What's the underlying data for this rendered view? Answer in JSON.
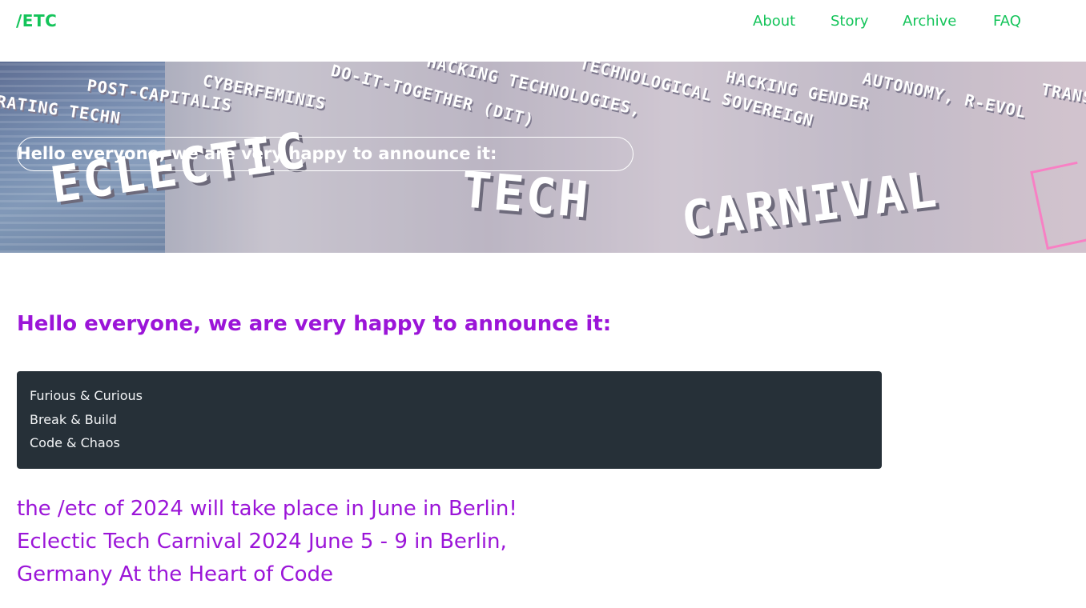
{
  "header": {
    "logo": "/ETC",
    "nav": [
      {
        "label": "About"
      },
      {
        "label": "Story"
      },
      {
        "label": "Archive"
      },
      {
        "label": "FAQ"
      }
    ],
    "accent_color": "#14c45a"
  },
  "banner": {
    "overlay_text": "Hello everyone, we are very happy to announce it:",
    "words": [
      "POST-CAPITALIS",
      "RATING TECHN",
      "CYBERFEMINIS",
      "DO-IT-TOGETHER (DIT)",
      "HACKING TECHNOLOGIES,",
      "TECHNOLOGICAL SOVEREIGN",
      "HACKING GENDER",
      "AUTONOMY, R-EVOL",
      "TRANS"
    ],
    "title_words": [
      "ECLECTIC",
      "TECH",
      "CARNIVAL"
    ]
  },
  "main": {
    "headline": "Hello everyone, we are very happy to announce it:",
    "code_lines": [
      "Furious & Curious",
      "Break & Build",
      "Code & Chaos"
    ],
    "announcement_lines": [
      "the /etc of 2024 will take place in June in Berlin!",
      "Eclectic Tech Carnival 2024 June 5 - 9 in Berlin,",
      "Germany At the Heart of Code"
    ],
    "text_color": "#9b15d8",
    "code_bg": "#263038"
  }
}
